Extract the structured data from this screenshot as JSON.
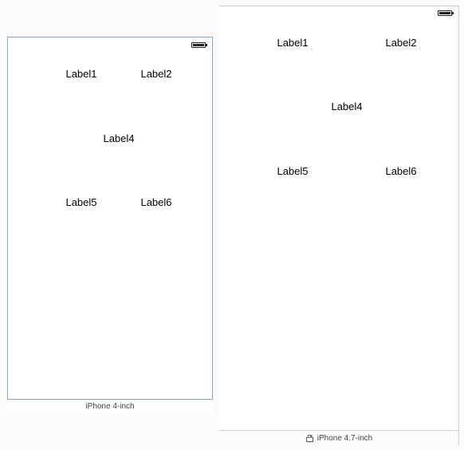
{
  "device_small": {
    "caption": "iPhone 4-inch",
    "labels": {
      "label1": "Label1",
      "label2": "Label2",
      "label4": "Label4",
      "label5": "Label5",
      "label6": "Label6"
    }
  },
  "device_large": {
    "caption": "iPhone 4.7-inch",
    "labels": {
      "label1": "Label1",
      "label2": "Label2",
      "label4": "Label4",
      "label5": "Label5",
      "label6": "Label6"
    }
  },
  "icons": {
    "battery": "battery-icon",
    "rotate": "rotate-icon"
  },
  "colors": {
    "selection_border": "#7fa7d6",
    "frame_border": "#cfcfcf"
  }
}
